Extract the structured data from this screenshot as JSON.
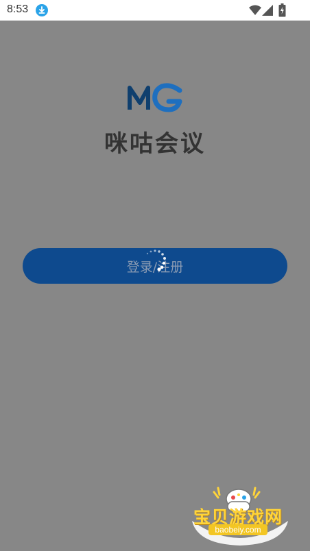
{
  "status_bar": {
    "time": "8:53",
    "icons": [
      "download-icon",
      "wifi-icon",
      "signal-icon",
      "battery-icon"
    ]
  },
  "app": {
    "name": "咪咕会议",
    "logo_icon": "mg-logo-icon"
  },
  "login_button": {
    "label": "登录/注册",
    "loading": true
  },
  "watermark": {
    "title": "宝贝游戏网",
    "url": "baobeiy.com"
  },
  "colors": {
    "overlay_background": "#878787",
    "status_bar_background": "#ffffff",
    "button_background": "#0e4a8e",
    "button_text": "#8a9bb3",
    "app_name": "#333333",
    "logo_blue": "#1e6fbf",
    "logo_dark": "#0f3f6e",
    "download_badge": "#2aa3e8"
  }
}
